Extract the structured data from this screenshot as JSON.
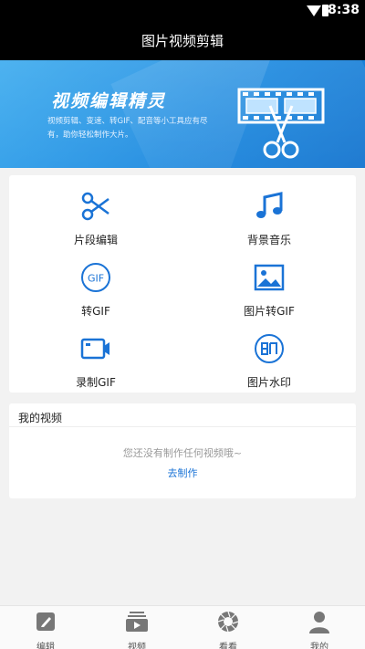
{
  "status_bar": {
    "time": "8:38"
  },
  "title_bar": {
    "title": "图片视频剪辑"
  },
  "banner": {
    "title": "视频编辑精灵",
    "subtitle": "视频剪辑、变速、转GIF、配音等小工具应有尽有，助你轻松制作大片。"
  },
  "features": [
    {
      "label": "片段编辑",
      "icon": "scissors-icon"
    },
    {
      "label": "背景音乐",
      "icon": "music-note-icon"
    },
    {
      "label": "转GIF",
      "icon": "gif-icon"
    },
    {
      "label": "图片转GIF",
      "icon": "image-icon"
    },
    {
      "label": "录制GIF",
      "icon": "video-camera-icon"
    },
    {
      "label": "图片水印",
      "icon": "watermark-icon"
    }
  ],
  "my_videos": {
    "header": "我的视频",
    "empty_text": "您还没有制作任何视频哦~",
    "action": "去制作"
  },
  "tabbar": [
    {
      "label": "编辑",
      "icon": "edit-icon"
    },
    {
      "label": "视频",
      "icon": "video-list-icon"
    },
    {
      "label": "看看",
      "icon": "aperture-icon"
    },
    {
      "label": "我的",
      "icon": "user-icon"
    }
  ],
  "colors": {
    "primary_blue": "#1a8ae0",
    "icon_blue": "#1a73d6",
    "header_black": "#000000"
  }
}
